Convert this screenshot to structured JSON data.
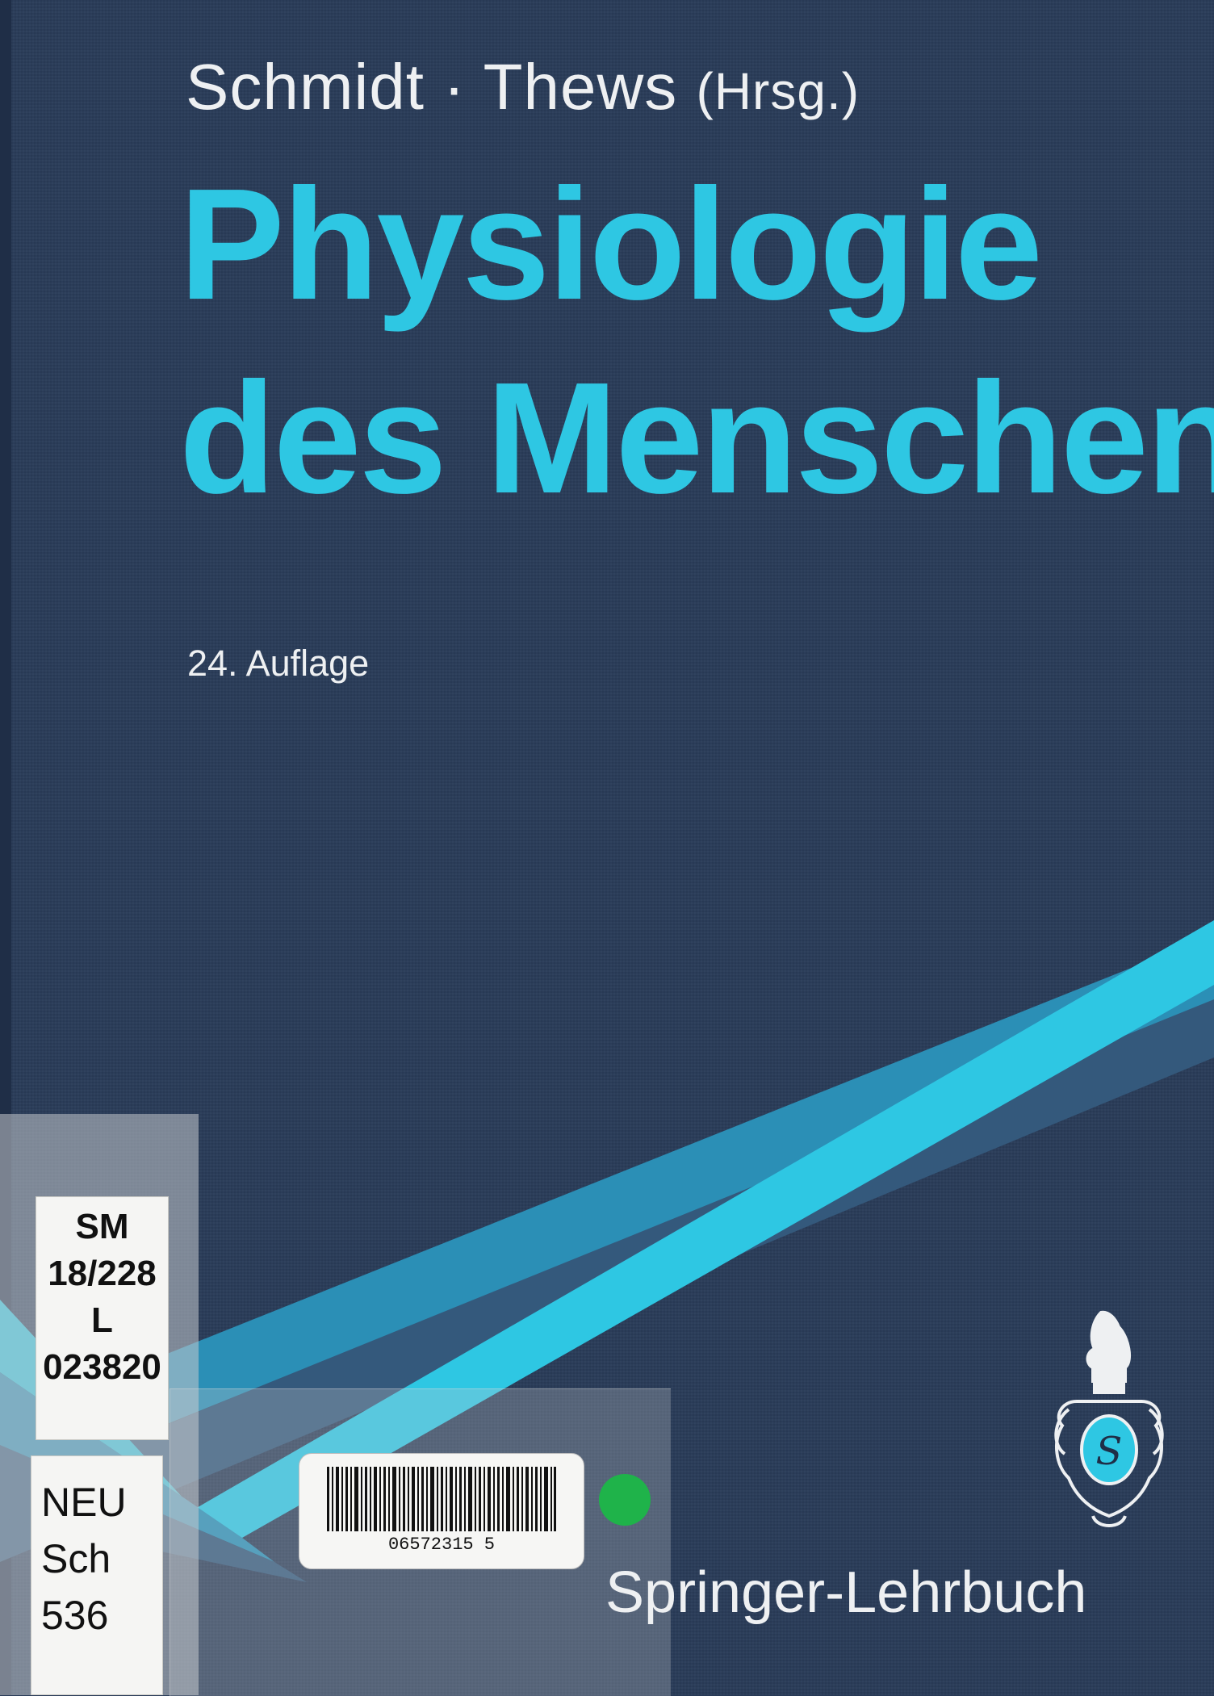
{
  "cover": {
    "authors": "Schmidt · Thews",
    "editor_note": "(Hrsg.)",
    "title_line1": "Physiologie",
    "title_line2": "des Menschen",
    "edition": "24. Auflage",
    "publisher_series": "Springer-Lehrbuch",
    "colors": {
      "background": "#293b58",
      "title_cyan": "#2ec7e3",
      "stripe_light": "#2ec7e3",
      "stripe_mid": "#2a9cc0",
      "stripe_dark": "#3a6b8f",
      "text_white": "#eef0f2"
    }
  },
  "library_labels": {
    "signature": [
      "SM",
      "18/228",
      "L",
      "023820"
    ],
    "location": [
      "NEU",
      "Sch",
      "536"
    ],
    "barcode_number": "06572315 5",
    "dot_color": "#1fb34a"
  },
  "logo": {
    "name": "springer-knight-logo-icon"
  }
}
